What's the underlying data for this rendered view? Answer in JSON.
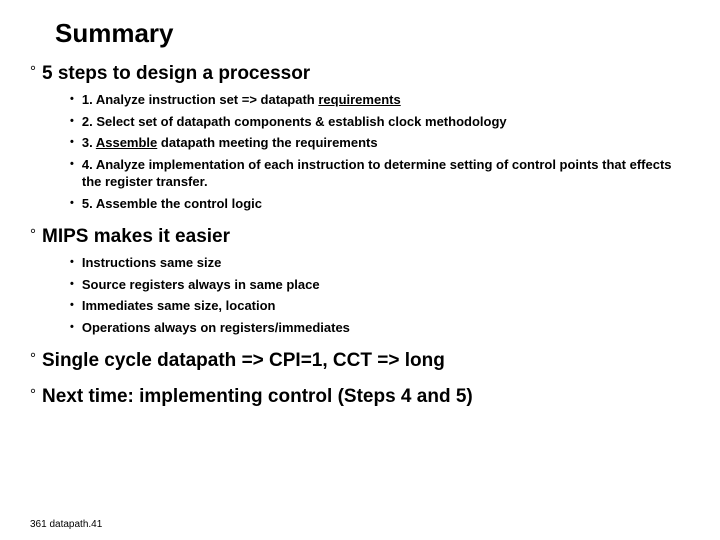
{
  "title": "Summary",
  "s1": {
    "head": "5 steps to design a processor",
    "i1a": "1. Analyze instruction set => datapath ",
    "i1b": "requirements",
    "i2": "2. Select set of datapath components & establish clock methodology",
    "i3a": "3. ",
    "i3b": "Assemble",
    "i3c": " datapath meeting the requirements",
    "i4": "4. Analyze implementation of each instruction to determine setting of control points that effects the register transfer.",
    "i5": "5. Assemble the control logic"
  },
  "s2": {
    "head": "MIPS makes it easier",
    "i1": "Instructions same size",
    "i2": "Source registers always in same place",
    "i3": "Immediates same size, location",
    "i4": "Operations always on registers/immediates"
  },
  "s3": {
    "head": "Single cycle datapath => CPI=1, CCT => long"
  },
  "s4": {
    "head": "Next time: implementing control (Steps 4 and 5)"
  },
  "footer": "361 datapath.41"
}
